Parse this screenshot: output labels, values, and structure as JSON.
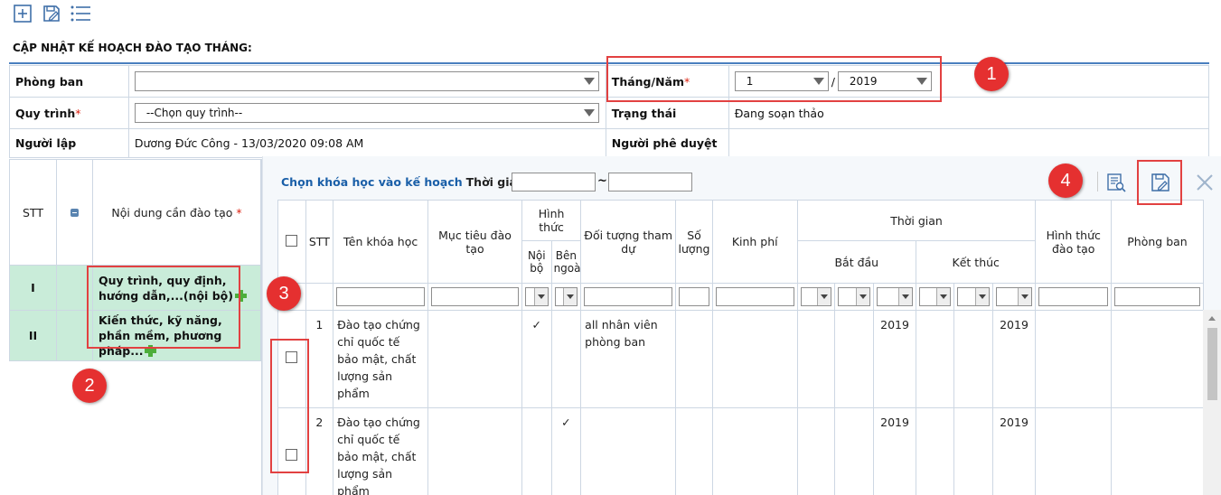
{
  "toolbar": {
    "icons": [
      "add-icon",
      "save-icon",
      "list-icon"
    ]
  },
  "page_title": "CẬP NHẬT KẾ HOẠCH ĐÀO TẠO THÁNG:",
  "form": {
    "department_label": "Phòng ban",
    "department_value": "",
    "month_year_label": "Tháng/Năm",
    "month_value": "1",
    "year_separator": "/",
    "year_value": "2019",
    "process_label": "Quy trình",
    "process_value": "--Chọn quy trình--",
    "status_label": "Trạng thái",
    "status_value": "Đang soạn thảo",
    "creator_label": "Người lập",
    "creator_value": "Dương Đức Công - 13/03/2020 09:08 AM",
    "approver_label": "Người phê duyệt",
    "approver_value": "",
    "required_mark": "*"
  },
  "left_table": {
    "col_stt": "STT",
    "col_content": "Nội dung cần đào tạo",
    "rows": [
      {
        "stt": "I",
        "content": "Quy trình, quy định, hướng dẫn,...(nội bộ)"
      },
      {
        "stt": "II",
        "content": "Kiến thức, kỹ năng, phần mềm, phương pháp..."
      }
    ]
  },
  "dialog": {
    "title": "Chọn khóa học vào kế hoạch",
    "time_label": "Thời gian:",
    "date_from": "",
    "date_to": "",
    "tilde": "~",
    "icons": [
      "preview-icon",
      "save-icon",
      "close-icon"
    ]
  },
  "grid": {
    "headers": {
      "stt": "STT",
      "course_name": "Tên khóa học",
      "objective": "Mục tiêu đào tạo",
      "form": "Hình thức",
      "internal": "Nội bộ",
      "external": "Bên ngoài",
      "audience": "Đối tượng tham dự",
      "quantity": "Số lượng",
      "cost": "Kinh phí",
      "time": "Thời gian",
      "start": "Bắt đầu",
      "end": "Kết thúc",
      "training_form": "Hình thức đào tạo",
      "department": "Phòng ban"
    },
    "rows": [
      {
        "stt": "1",
        "name": "Đào tạo chứng chỉ quốc tế bảo mật, chất lượng sản phẩm",
        "internal": "✓",
        "external": "",
        "audience": "all nhân viên phòng ban",
        "start_year": "2019",
        "end_year": "2019"
      },
      {
        "stt": "2",
        "name": "Đào tạo chứng chỉ quốc tế bảo mật, chất lượng sản phẩm",
        "internal": "",
        "external": "✓",
        "audience": "",
        "start_year": "2019",
        "end_year": "2019"
      }
    ]
  },
  "markers": [
    "1",
    "2",
    "3",
    "4"
  ],
  "colors": {
    "accent": "#1a5fa8",
    "highlight_row": "#c9ecd9",
    "annotation": "#e53030"
  }
}
